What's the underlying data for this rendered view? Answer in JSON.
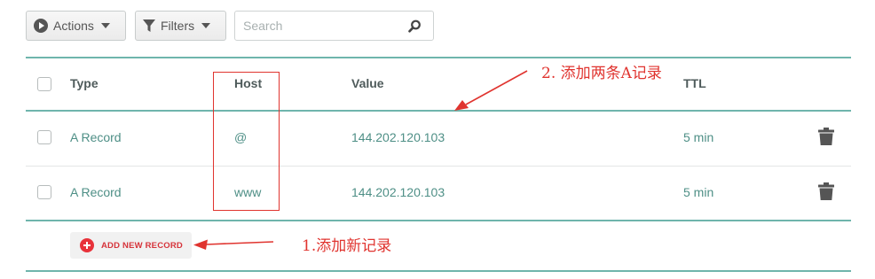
{
  "toolbar": {
    "actions_label": "Actions",
    "filters_label": "Filters",
    "search_placeholder": "Search"
  },
  "table": {
    "headers": {
      "type": "Type",
      "host": "Host",
      "value": "Value",
      "ttl": "TTL"
    },
    "rows": [
      {
        "type": "A Record",
        "host": "@",
        "value": "144.202.120.103",
        "ttl": "5 min"
      },
      {
        "type": "A Record",
        "host": "www",
        "value": "144.202.120.103",
        "ttl": "5 min"
      }
    ],
    "add_new_label": "ADD NEW RECORD"
  },
  "annotations": {
    "note_add": "1.添加新记录",
    "note_records": "2. 添加两条A记录"
  },
  "colors": {
    "accent_teal": "#6fb5ac",
    "value_text": "#4e8f86",
    "annotation_red": "#e0342f",
    "add_red": "#e8323a"
  }
}
